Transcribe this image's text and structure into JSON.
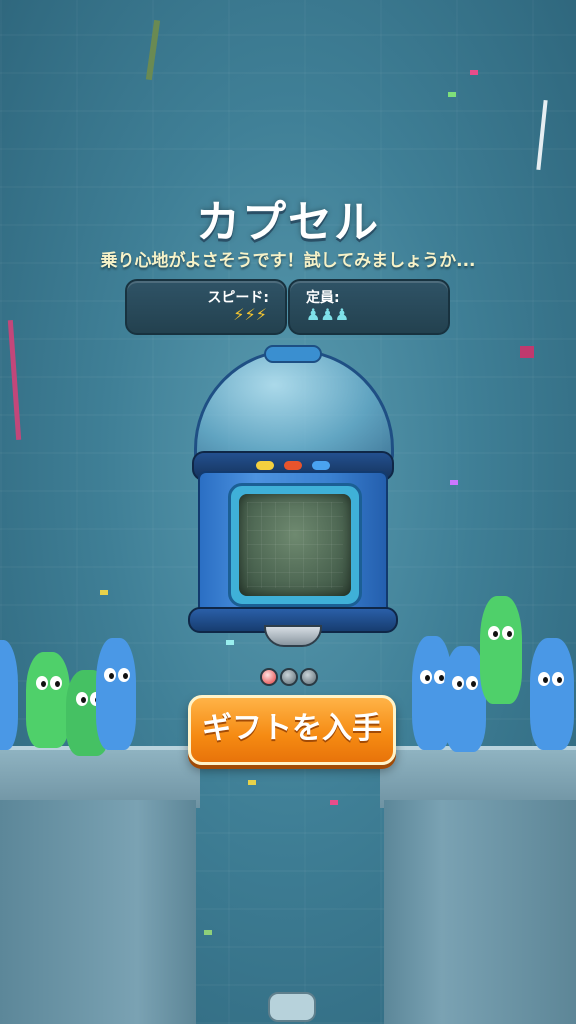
{
  "screen": {
    "title": "カプセル",
    "subtitle": "乗り心地がよさそうです！試してみましょうか..."
  },
  "stats": {
    "speed_label": "スピード:",
    "speed_value": "⚡⚡⚡",
    "capacity_label": "定員:",
    "capacity_value": "♟♟♟"
  },
  "pager": {
    "page_count": 3,
    "active_index": 0
  },
  "actions": {
    "gift_label": "ギフトを入手"
  },
  "colors": {
    "accent_orange": "#f58a12",
    "background": "#3f7f96",
    "character_blue": "#4a98e6",
    "character_green": "#4fd06a"
  }
}
